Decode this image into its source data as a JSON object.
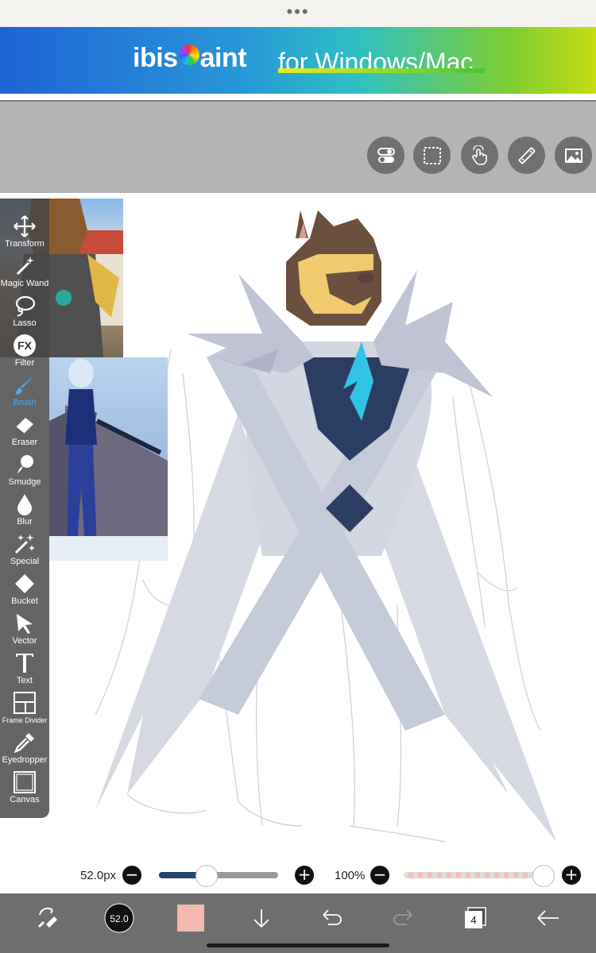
{
  "banner": {
    "brand": "ibisPaint",
    "tagline": "for Windows/Mac"
  },
  "toolbar_icons": [
    "toggle-icon",
    "selection-icon",
    "hand-icon",
    "ruler-icon",
    "image-icon"
  ],
  "tools": [
    {
      "label": "Transform",
      "icon": "move-icon"
    },
    {
      "label": "Magic Wand",
      "icon": "magic-wand-icon"
    },
    {
      "label": "Lasso",
      "icon": "lasso-icon"
    },
    {
      "label": "Filter",
      "icon": "fx-icon"
    },
    {
      "label": "Brush",
      "icon": "brush-icon",
      "active": true
    },
    {
      "label": "Eraser",
      "icon": "eraser-icon"
    },
    {
      "label": "Smudge",
      "icon": "smudge-icon"
    },
    {
      "label": "Blur",
      "icon": "drop-icon"
    },
    {
      "label": "Special",
      "icon": "sparkle-icon"
    },
    {
      "label": "Bucket",
      "icon": "bucket-icon"
    },
    {
      "label": "Vector",
      "icon": "cursor-icon"
    },
    {
      "label": "Text",
      "icon": "text-icon"
    },
    {
      "label": "Frame Divider",
      "icon": "frame-icon"
    },
    {
      "label": "Eyedropper",
      "icon": "eyedropper-icon"
    },
    {
      "label": "Canvas",
      "icon": "canvas-icon"
    }
  ],
  "brush": {
    "size_label": "52.0px",
    "size_fraction": 0.39,
    "opacity_label": "100%",
    "opacity_fraction": 1.0,
    "size_preview": "52.0",
    "color": "#f1b9b0"
  },
  "fx_text": "FX",
  "layers_count": "4",
  "colors": {
    "accent": "#4aa8f0",
    "slider_fill": "#23466f"
  }
}
